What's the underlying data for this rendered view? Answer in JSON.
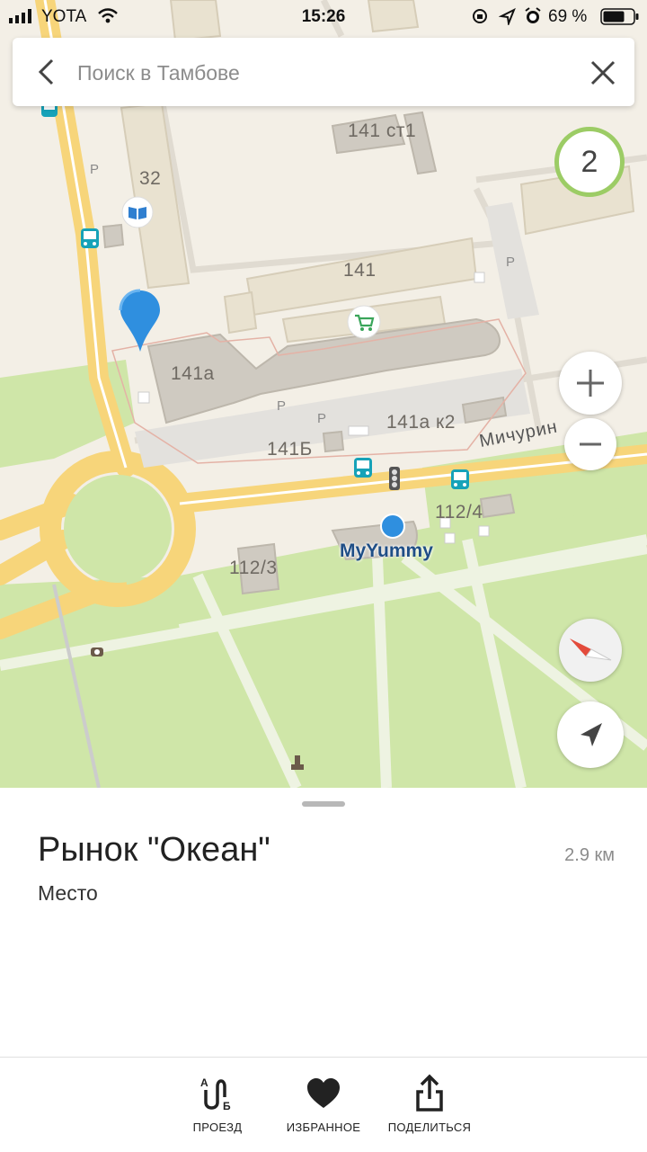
{
  "status_bar": {
    "carrier": "YOTA",
    "time": "15:26",
    "battery": "69 %"
  },
  "search": {
    "placeholder": "Поиск в Тамбове"
  },
  "map": {
    "cluster_count": "2",
    "street_label": "Мичурин",
    "my_location_label": "MyYummy",
    "building_labels": [
      "141 ст1",
      "32",
      "141",
      "141а",
      "141а к2",
      "141Б",
      "112/4",
      "112/3"
    ],
    "parking_label": "P"
  },
  "place": {
    "title": "Рынок \"Океан\"",
    "type": "Место",
    "distance": "2.9 км"
  },
  "toolbar": {
    "route_label": "ПРОЕЗД",
    "favorites_label": "ИЗБРАННОЕ",
    "share_label": "ПОДЕЛИТЬСЯ"
  },
  "colors": {
    "map_background": "#f3efe6",
    "park": "#cfe6a8",
    "road_major": "#f7d57a",
    "pin_blue": "#2f8fdf",
    "cluster_ring": "#9ccc65"
  }
}
